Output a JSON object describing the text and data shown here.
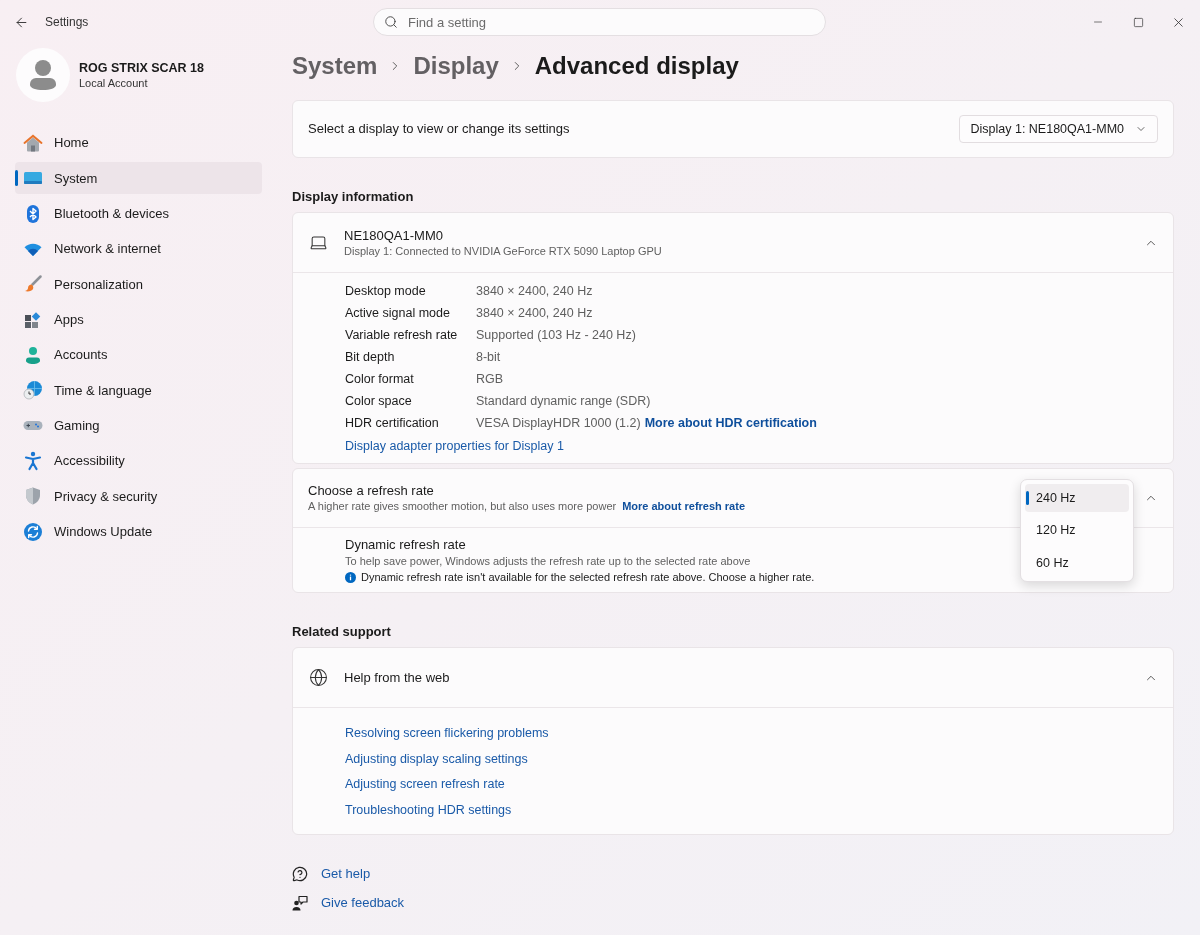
{
  "window": {
    "title": "Settings"
  },
  "search": {
    "placeholder": "Find a setting"
  },
  "account": {
    "name": "ROG STRIX SCAR 18",
    "type": "Local Account"
  },
  "sidebar": {
    "items": [
      {
        "label": "Home",
        "selected": false
      },
      {
        "label": "System",
        "selected": true
      },
      {
        "label": "Bluetooth & devices",
        "selected": false
      },
      {
        "label": "Network & internet",
        "selected": false
      },
      {
        "label": "Personalization",
        "selected": false
      },
      {
        "label": "Apps",
        "selected": false
      },
      {
        "label": "Accounts",
        "selected": false
      },
      {
        "label": "Time & language",
        "selected": false
      },
      {
        "label": "Gaming",
        "selected": false
      },
      {
        "label": "Accessibility",
        "selected": false
      },
      {
        "label": "Privacy & security",
        "selected": false
      },
      {
        "label": "Windows Update",
        "selected": false
      }
    ]
  },
  "breadcrumb": [
    {
      "label": "System",
      "current": false
    },
    {
      "label": "Display",
      "current": false
    },
    {
      "label": "Advanced display",
      "current": true
    }
  ],
  "display_select": {
    "label": "Select a display to view or change its settings",
    "value": "Display 1: NE180QA1-MM0"
  },
  "display_information": {
    "heading": "Display information",
    "device": {
      "name": "NE180QA1-MM0",
      "connection": "Display 1: Connected to NVIDIA GeForce RTX 5090 Laptop GPU",
      "expanded": true
    },
    "details": [
      {
        "label": "Desktop mode",
        "value": "3840 × 2400, 240 Hz"
      },
      {
        "label": "Active signal mode",
        "value": "3840 × 2400, 240 Hz"
      },
      {
        "label": "Variable refresh rate",
        "value": "Supported (103 Hz - 240 Hz)"
      },
      {
        "label": "Bit depth",
        "value": "8-bit"
      },
      {
        "label": "Color format",
        "value": "RGB"
      },
      {
        "label": "Color space",
        "value": "Standard dynamic range (SDR)"
      },
      {
        "label": "HDR certification",
        "value": "VESA DisplayHDR 1000 (1.2)",
        "link": "More about HDR certification"
      }
    ],
    "adapter_link": "Display adapter properties for Display 1"
  },
  "refresh_rate": {
    "title": "Choose a refresh rate",
    "description": "A higher rate gives smoother motion, but also uses more power",
    "link": "More about refresh rate",
    "expanded": true,
    "options": [
      {
        "label": "240 Hz",
        "selected": true
      },
      {
        "label": "120 Hz",
        "selected": false
      },
      {
        "label": "60 Hz",
        "selected": false
      }
    ],
    "dynamic": {
      "title": "Dynamic refresh rate",
      "description": "To help save power, Windows adjusts the refresh rate up to the selected rate above",
      "notice": "Dynamic refresh rate isn't available for the selected refresh rate above. Choose a higher rate."
    }
  },
  "related_support": {
    "heading": "Related support",
    "help": {
      "title": "Help from the web",
      "expanded": true,
      "links": [
        "Resolving screen flickering problems",
        "Adjusting display scaling settings",
        "Adjusting screen refresh rate",
        "Troubleshooting HDR settings"
      ]
    }
  },
  "footer_links": [
    "Get help",
    "Give feedback"
  ]
}
